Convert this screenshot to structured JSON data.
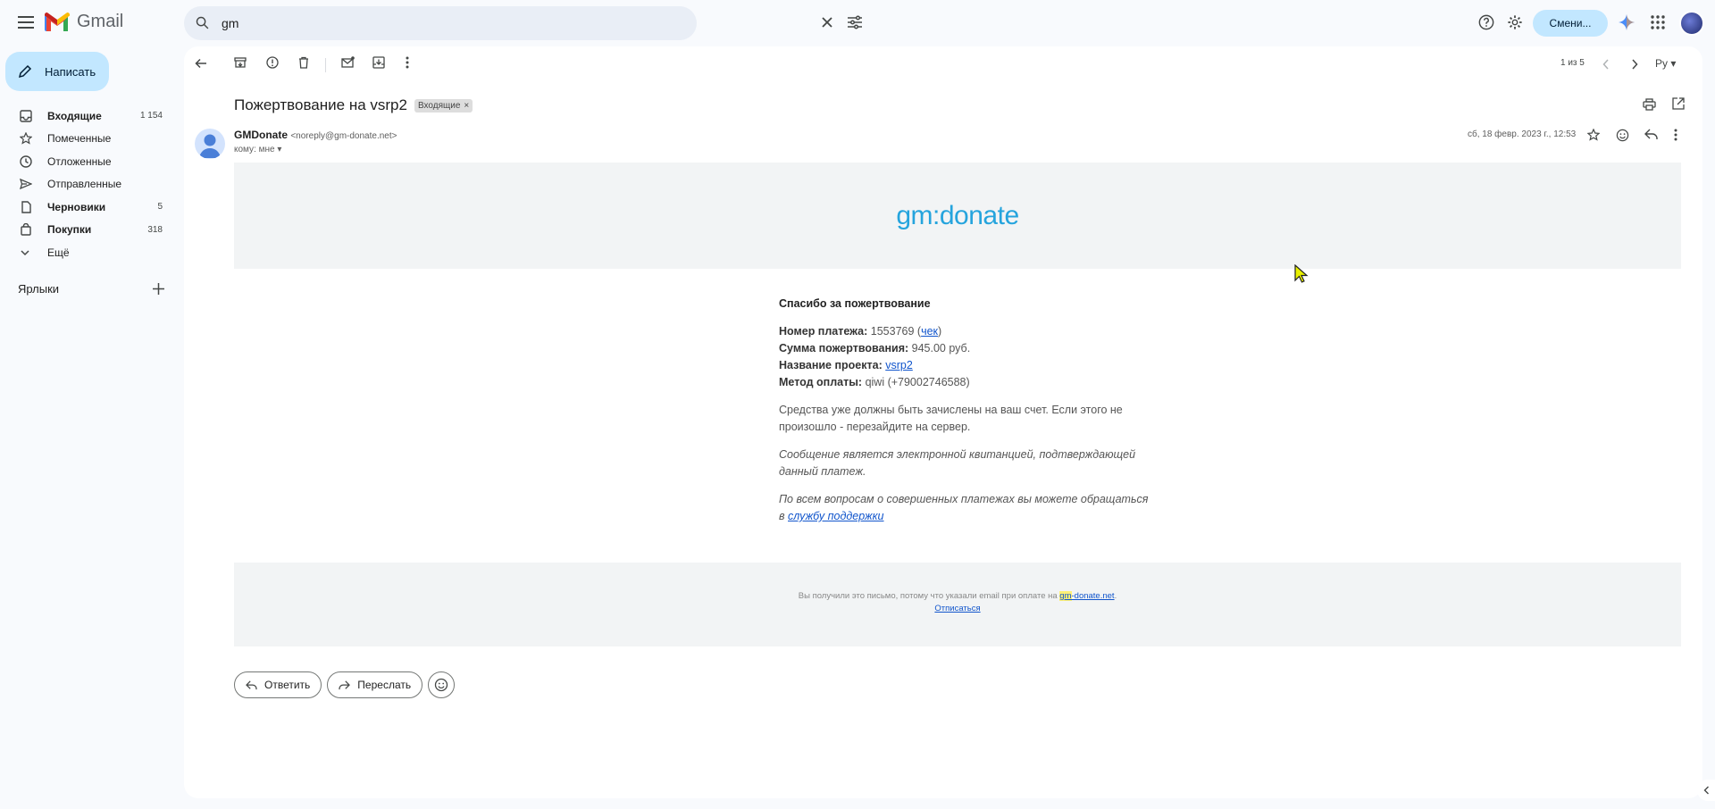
{
  "app": {
    "name": "Gmail"
  },
  "search": {
    "value": "gm"
  },
  "header": {
    "switch_label": "Смени..."
  },
  "compose": {
    "label": "Написать"
  },
  "nav": {
    "items": [
      {
        "label": "Входящие",
        "count": "1 154",
        "bold": true,
        "icon": "inbox-icon"
      },
      {
        "label": "Помеченные",
        "count": "",
        "bold": false,
        "icon": "star-icon"
      },
      {
        "label": "Отложенные",
        "count": "",
        "bold": false,
        "icon": "clock-icon"
      },
      {
        "label": "Отправленные",
        "count": "",
        "bold": false,
        "icon": "send-icon"
      },
      {
        "label": "Черновики",
        "count": "5",
        "bold": true,
        "icon": "draft-icon"
      },
      {
        "label": "Покупки",
        "count": "318",
        "bold": true,
        "icon": "bag-icon"
      },
      {
        "label": "Ещё",
        "count": "",
        "bold": false,
        "icon": "chevron-down-icon"
      }
    ],
    "labels_heading": "Ярлыки"
  },
  "toolbar": {
    "pager": "1 из 5",
    "lang": "Ру"
  },
  "message": {
    "subject": "Пожертвование на vsrp2",
    "badge": "Входящие",
    "sender_name": "GMDonate",
    "sender_addr": "<noreply@gm-donate.net>",
    "to": "кому: мне",
    "date": "сб, 18 февр. 2023 г., 12:53"
  },
  "email": {
    "logo": "gm:donate",
    "thanks": "Спасибо за пожертвование",
    "payment_label": "Номер платежа:",
    "payment_value": "1553769",
    "receipt_link": "чек",
    "amount_label": "Сумма пожертвования:",
    "amount_value": "945.00 руб.",
    "project_label": "Название проекта:",
    "project_link": "vsrp2",
    "method_label": "Метод оплаты:",
    "method_value": "qiwi (+79002746588)",
    "funds_text": "Средства уже должны быть зачислены на ваш счет. Если этого не произошло - перезайдите на сервер.",
    "receipt_text": "Сообщение является электронной квитанцией, подтверждающей данный платеж.",
    "support_text": "По всем вопросам о совершенных платежах вы можете обращаться в",
    "support_link": "службу поддержки",
    "footer_text": "Вы получили это письмо, потому что указали email при оплате на",
    "footer_link_hl": "gm",
    "footer_link_rest": "-donate.net",
    "footer_dot": ".",
    "unsubscribe": "Отписаться"
  },
  "actions": {
    "reply": "Ответить",
    "forward": "Переслать"
  }
}
